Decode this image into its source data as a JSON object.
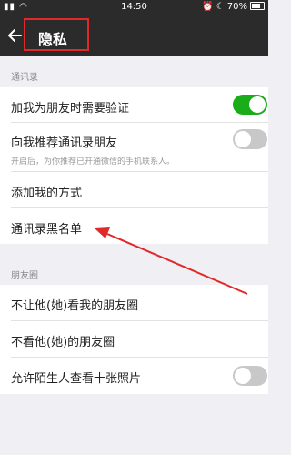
{
  "status_bar": {
    "time": "14:50",
    "battery": "70%"
  },
  "header": {
    "title": "隐私"
  },
  "sections": {
    "contacts": {
      "header": "通讯录",
      "verify_label": "加我为朋友时需要验证",
      "verify_on": true,
      "recommend_label": "向我推荐通讯录朋友",
      "recommend_on": false,
      "recommend_desc": "开启后，为你推荐已开通微信的手机联系人。",
      "add_methods_label": "添加我的方式",
      "blacklist_label": "通讯录黑名单"
    },
    "moments": {
      "header": "朋友圈",
      "hide_my_label": "不让他(她)看我的朋友圈",
      "hide_their_label": "不看他(她)的朋友圈",
      "strangers_label": "允许陌生人查看十张照片",
      "strangers_on": false
    }
  },
  "colors": {
    "annotation": "#e02a2a",
    "toggle_on": "#1aad19",
    "toggle_off": "#c8c8c8"
  }
}
